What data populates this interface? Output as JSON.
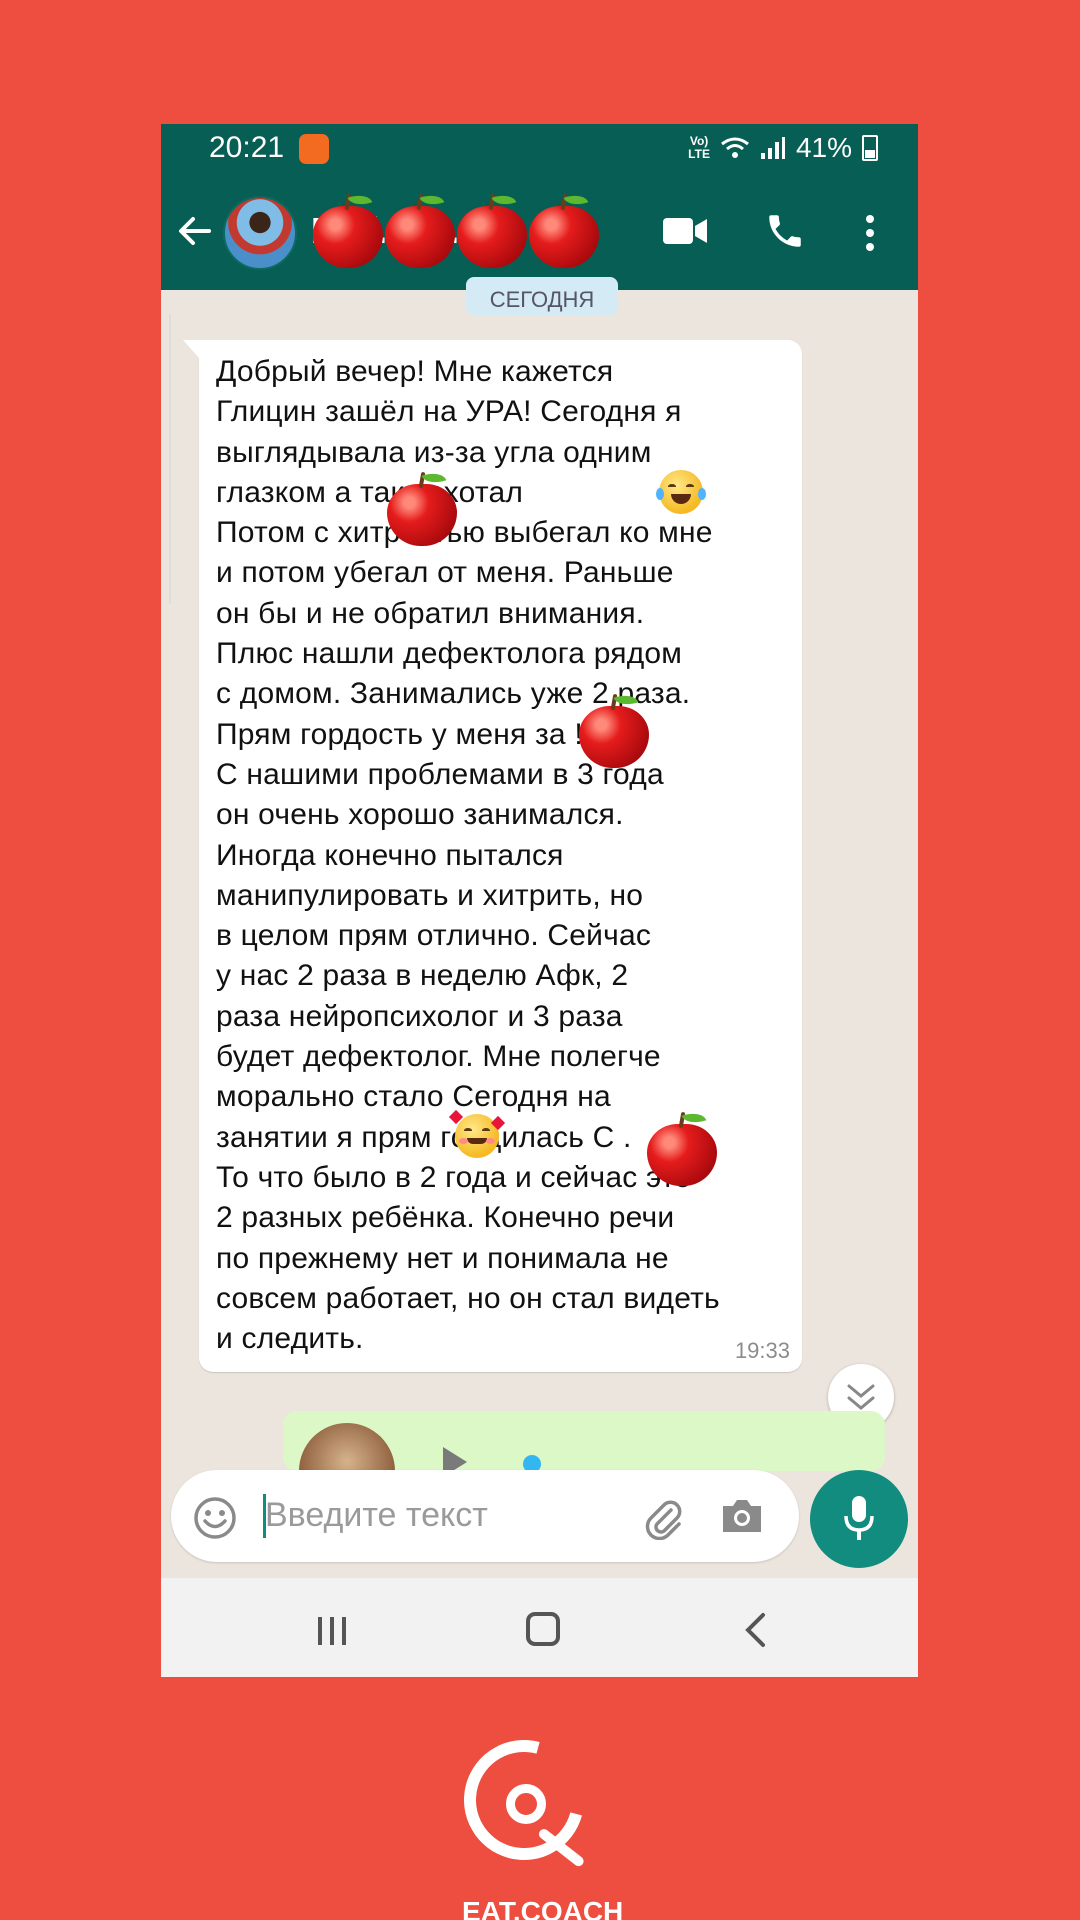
{
  "status_bar": {
    "time": "20:21",
    "network": "Vo) LTE",
    "battery": "41%"
  },
  "header": {
    "contact_name": "Е...(......)..."
  },
  "chat": {
    "date_chip": "СЕГОДНЯ",
    "message": {
      "text": "Добрый вечер! Мне кажется\nГлицин зашёл на УРА! Сегодня я\nвыглядывала из-за угла одним\nглазком а         так хохотал\nПотом с хитростью выбегал ко мне\nи потом убегал от меня. Раньше\nон бы и не обратил внимания.\nПлюс нашли дефектолога рядом\nс домом. Занимались уже 2 раза.\nПрям гордость у меня за        !\nС нашими проблемами в 3 года\nон очень хорошо занимался.\nИногда конечно пытался\nманипулировать и хитрить, но\nв целом прям отлично. Сейчас\nу нас 2 раза в неделю Афк, 2\nраза нейропсихолог и 3 раза\nбудет дефектолог. Мне полегче\nморально стало     Сегодня на\nзанятии я прям гордилась С      .\nТо что было в 2 года и сейчас это\n2 разных ребёнка. Конечно речи\nпо прежнему нет и понимала не\nсовсем работает, но он стал видеть\nи следить.",
      "time": "19:33"
    }
  },
  "composer": {
    "placeholder": "Введите текст"
  },
  "brand": {
    "logo_text": "EAT.COACH"
  },
  "colors": {
    "background": "#ED4E3F",
    "header": "#075E54",
    "accent": "#128C7E",
    "outgoing_bubble": "#DCF8C6"
  }
}
